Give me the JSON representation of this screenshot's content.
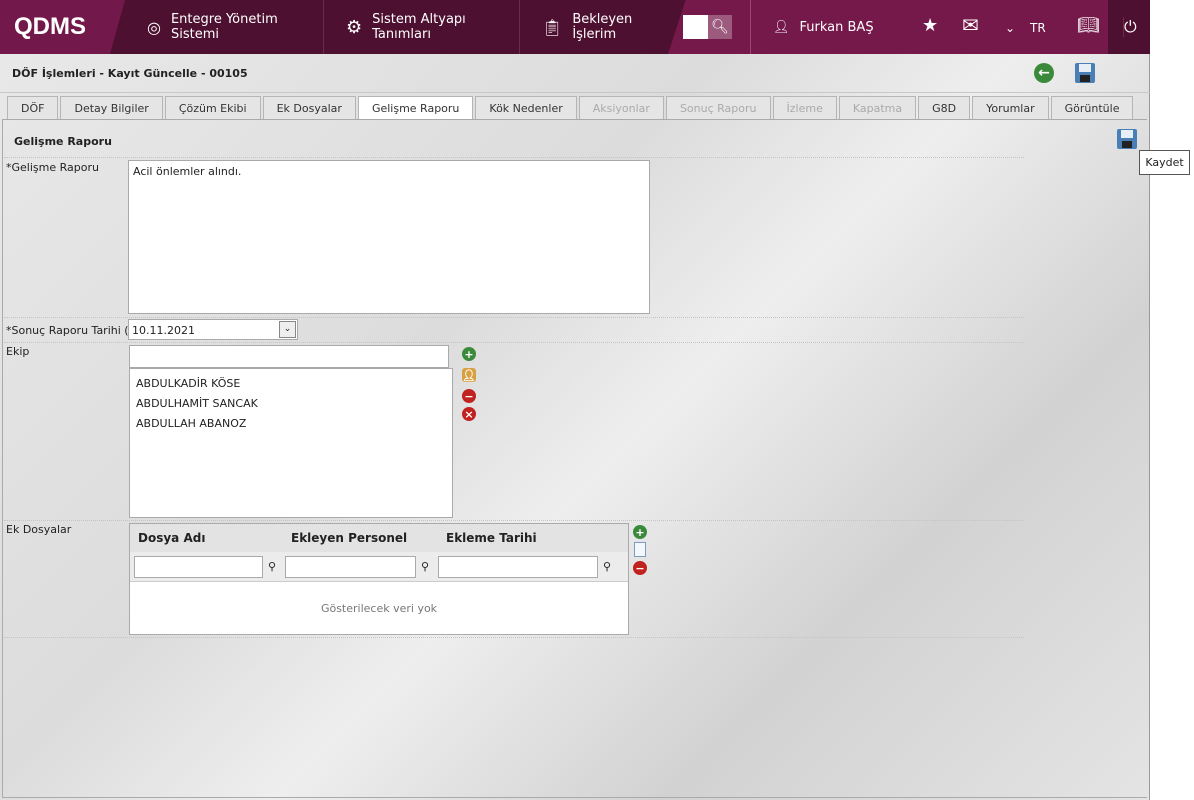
{
  "header": {
    "logo": "QDMS",
    "nav": [
      "Entegre Yönetim Sistemi",
      "Sistem Altyapı Tanımları",
      "Bekleyen İşlerim"
    ],
    "user": "Furkan BAŞ",
    "lang": "TR"
  },
  "page": {
    "title": "DÖF İşlemleri - Kayıt Güncelle - 00105"
  },
  "tabs": [
    {
      "label": "DÖF"
    },
    {
      "label": "Detay Bilgiler"
    },
    {
      "label": "Çözüm Ekibi"
    },
    {
      "label": "Ek Dosyalar"
    },
    {
      "label": "Gelişme Raporu"
    },
    {
      "label": "Kök Nedenler"
    },
    {
      "label": "Aksiyonlar"
    },
    {
      "label": "Sonuç Raporu"
    },
    {
      "label": "İzleme"
    },
    {
      "label": "Kapatma"
    },
    {
      "label": "G8D"
    },
    {
      "label": "Yorumlar"
    },
    {
      "label": "Görüntüle"
    }
  ],
  "form": {
    "section_title": "Gelişme Raporu",
    "report_label": "*Gelişme Raporu",
    "report_value": "Acil önlemler alındı.",
    "date_label": "*Sonuç Raporu Tarihi (P)",
    "date_value": "10.11.2021",
    "team_label": "Ekip",
    "team": [
      "ABDULKADİR KÖSE",
      "ABDULHAMİT SANCAK",
      "ABDULLAH ABANOZ"
    ],
    "files_label": "Ek Dosyalar"
  },
  "grid": {
    "columns": [
      "Dosya Adı",
      "Ekleyen Personel",
      "Ekleme Tarihi"
    ],
    "empty": "Gösterilecek veri yok"
  },
  "tooltip": "Kaydet"
}
